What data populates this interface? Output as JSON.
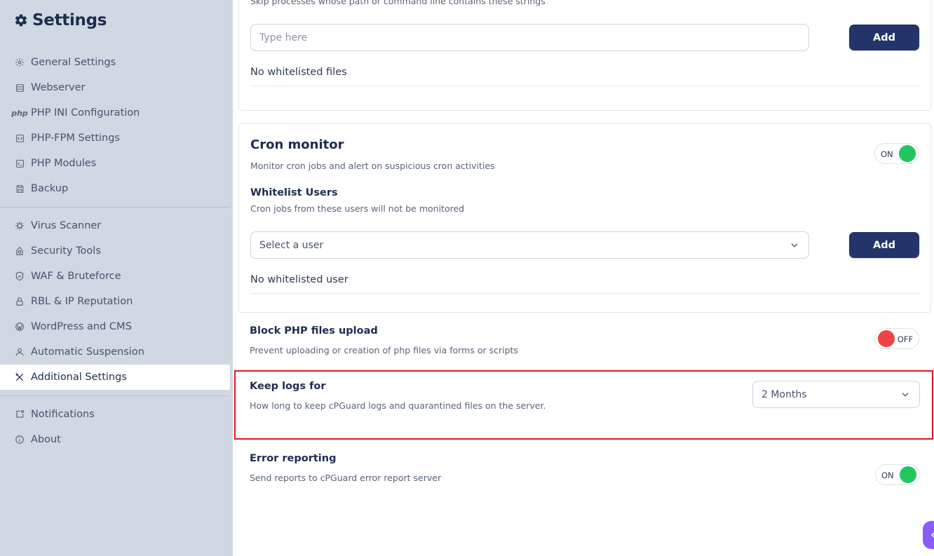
{
  "sidebar": {
    "title": "Settings",
    "items": [
      {
        "label": "General Settings",
        "icon": "gear-outline-icon"
      },
      {
        "label": "Webserver",
        "icon": "server-icon"
      },
      {
        "label": "PHP INI Configuration",
        "icon": "php-icon"
      },
      {
        "label": "PHP-FPM Settings",
        "icon": "code-window-icon"
      },
      {
        "label": "PHP Modules",
        "icon": "terminal-icon"
      },
      {
        "label": "Backup",
        "icon": "floppy-icon"
      },
      {
        "label": "Virus Scanner",
        "icon": "virus-icon"
      },
      {
        "label": "Security Tools",
        "icon": "security-tools-icon"
      },
      {
        "label": "WAF & Bruteforce",
        "icon": "shield-icon"
      },
      {
        "label": "RBL & IP Reputation",
        "icon": "lock-icon"
      },
      {
        "label": "WordPress and CMS",
        "icon": "wordpress-icon"
      },
      {
        "label": "Automatic Suspension",
        "icon": "user-icon"
      },
      {
        "label": "Additional Settings",
        "icon": "tools-icon"
      },
      {
        "label": "Notifications",
        "icon": "notification-icon"
      },
      {
        "label": "About",
        "icon": "info-icon"
      }
    ],
    "active_item": "Additional Settings"
  },
  "processes": {
    "description_partial": "Skip processes whose path or command line contains these strings",
    "input_placeholder": "Type here",
    "add_label": "Add",
    "empty_text": "No whitelisted files"
  },
  "cron": {
    "title": "Cron monitor",
    "description": "Monitor cron jobs and alert on suspicious cron activities",
    "toggle": "ON",
    "whitelist_title": "Whitelist Users",
    "whitelist_desc": "Cron jobs from these users will not be monitored",
    "select_placeholder": "Select a user",
    "add_label": "Add",
    "empty_text": "No whitelisted user"
  },
  "block_php": {
    "title": "Block PHP files upload",
    "description": "Prevent uploading or creation of php files via forms or scripts",
    "toggle": "OFF"
  },
  "keep_logs": {
    "title": "Keep logs for",
    "description": "How long to keep cPGuard logs and quarantined files on the server.",
    "selected": "2 Months"
  },
  "error_reporting": {
    "title": "Error reporting",
    "description": "Send reports to cPGuard error report server",
    "toggle": "ON"
  },
  "colors": {
    "sidebar_bg": "#cfd8e3",
    "primary_button": "#23346a",
    "toggle_on": "#22c55e",
    "toggle_off": "#ef4444",
    "highlight": "#e3141b"
  }
}
